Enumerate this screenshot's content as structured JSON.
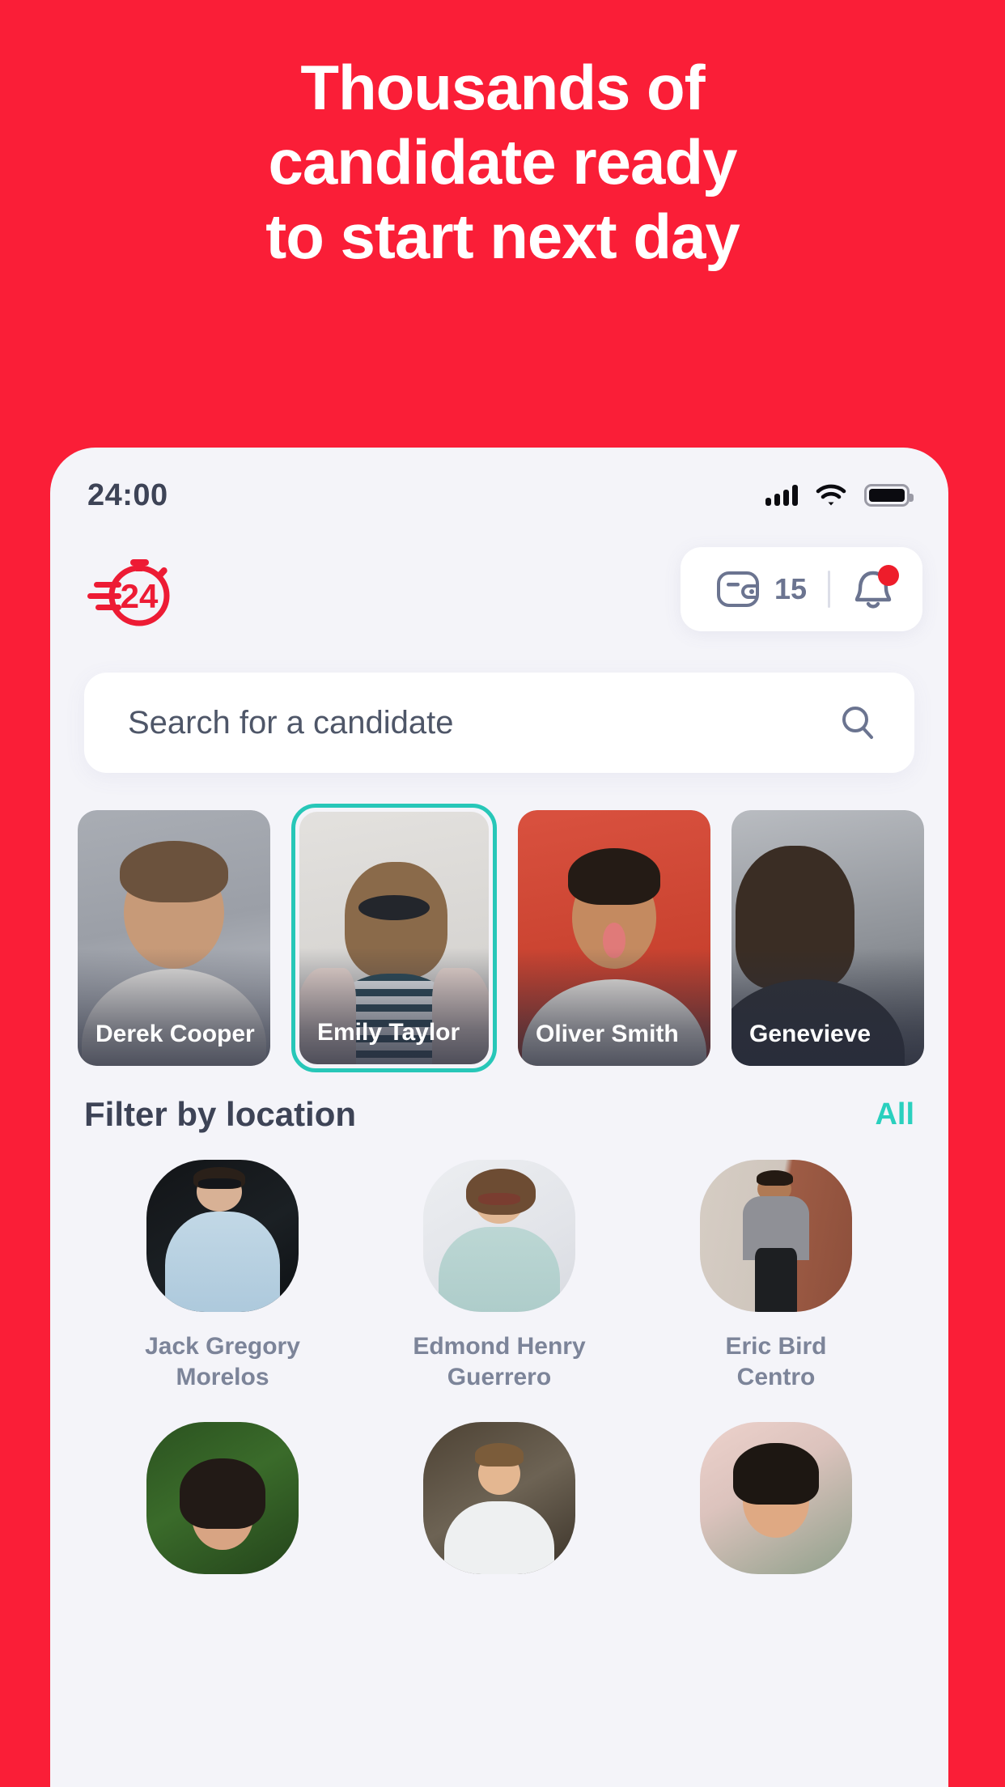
{
  "hero": {
    "lines": [
      "Thousands of",
      "candidate ready",
      "to start next day"
    ]
  },
  "colors": {
    "brand_red": "#FA1E37",
    "accent_teal": "#2AD0BE",
    "phone_bg": "#F4F4F9",
    "text_dark": "#3D4356",
    "text_muted": "#7C8499"
  },
  "statusbar": {
    "time": "24:00",
    "signal_icon": "signal-bars-icon",
    "wifi_icon": "wifi-icon",
    "battery_icon": "battery-icon"
  },
  "appbar": {
    "logo_name": "stopwatch-24-logo",
    "logo_text": "24",
    "wallet_icon": "wallet-icon",
    "wallet_count": "15",
    "bell_icon": "bell-icon",
    "has_notification": true
  },
  "search": {
    "placeholder": "Search for a candidate",
    "value": "",
    "icon": "search-icon"
  },
  "candidate_cards": [
    {
      "name": "Derek Cooper",
      "selected": false
    },
    {
      "name": "Emily Taylor",
      "selected": true
    },
    {
      "name": "Oliver Smith",
      "selected": false
    },
    {
      "name": "Genevieve",
      "selected": false
    }
  ],
  "filter": {
    "title": "Filter by location",
    "all_label": "All"
  },
  "people": [
    {
      "line1": "Jack Gregory",
      "line2": "Morelos"
    },
    {
      "line1": "Edmond Henry",
      "line2": "Guerrero"
    },
    {
      "line1": "Eric Bird",
      "line2": "Centro"
    },
    {
      "line1": "",
      "line2": ""
    },
    {
      "line1": "",
      "line2": ""
    },
    {
      "line1": "",
      "line2": ""
    }
  ]
}
